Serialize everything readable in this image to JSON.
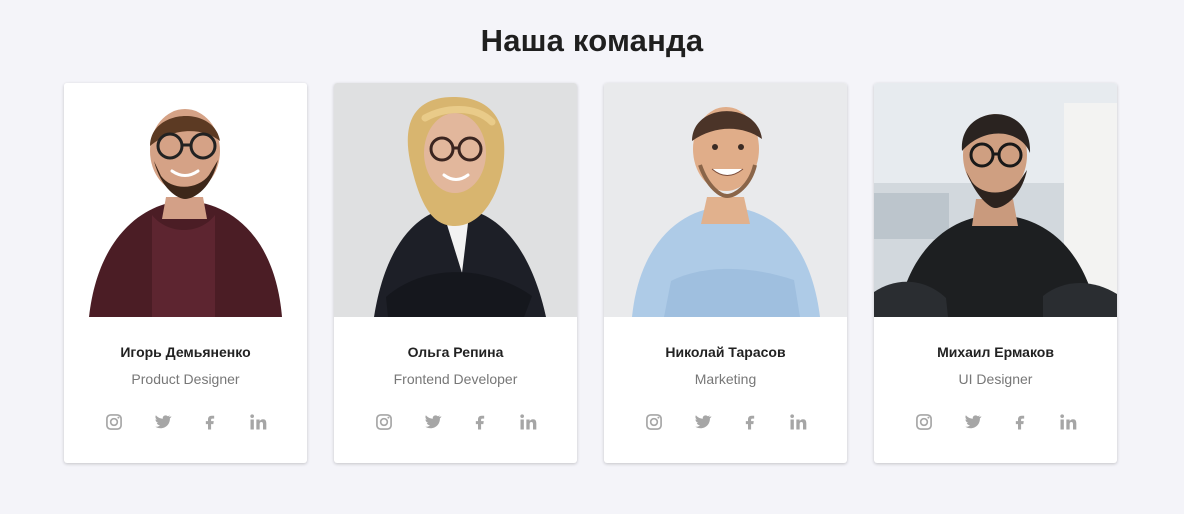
{
  "section": {
    "title": "Наша команда"
  },
  "colors": {
    "page_bg": "#f4f4f9",
    "card_bg": "#ffffff",
    "icon": "#a6a6a6",
    "title": "#1f1f1f",
    "role": "#777777"
  },
  "team": [
    {
      "name": "Игорь Демьяненко",
      "role": "Product Designer",
      "photo_bg": "#ffffff",
      "socials": [
        "instagram-icon",
        "twitter-icon",
        "facebook-icon",
        "linkedin-icon"
      ]
    },
    {
      "name": "Ольга Репина",
      "role": "Frontend Developer",
      "photo_bg": "#dfe0e1",
      "socials": [
        "instagram-icon",
        "twitter-icon",
        "facebook-icon",
        "linkedin-icon"
      ]
    },
    {
      "name": "Николай Тарасов",
      "role": "Marketing",
      "photo_bg": "#e9eaec",
      "socials": [
        "instagram-icon",
        "twitter-icon",
        "facebook-icon",
        "linkedin-icon"
      ]
    },
    {
      "name": "Михаил Ермаков",
      "role": "UI Designer",
      "photo_bg": "#e7ebef",
      "socials": [
        "instagram-icon",
        "twitter-icon",
        "facebook-icon",
        "linkedin-icon"
      ]
    }
  ]
}
